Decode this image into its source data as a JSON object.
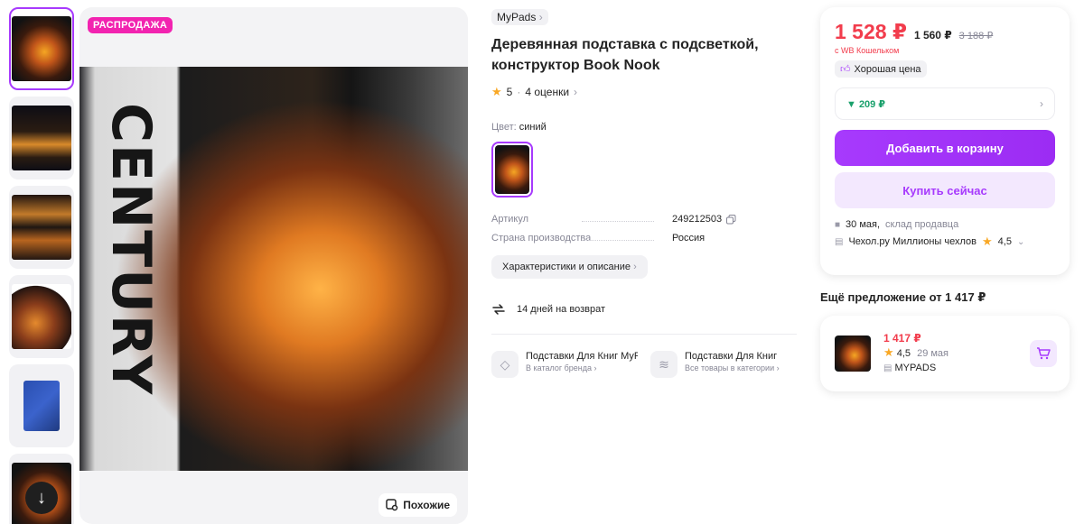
{
  "gallery": {
    "sale_badge": "РАСПРОДАЖА",
    "similar_label": "Похожие",
    "spine_text": "CENTURY"
  },
  "product": {
    "brand": "MyPads",
    "title": "Деревянная подставка с подсветкой, конструктор Book Nook",
    "rating": "5",
    "reviews": "4 оценки",
    "color_label": "Цвет:",
    "color_value": "синий",
    "specs": [
      {
        "key": "Артикул",
        "value": "249212503"
      },
      {
        "key": "Страна производства",
        "value": "Россия"
      }
    ],
    "characteristics_button": "Характеристики и описание",
    "return_policy": "14 дней на возврат",
    "categories": [
      {
        "name": "Подставки Для Книг MyPads",
        "sub": "В каталог бренда"
      },
      {
        "name": "Подставки Для Книг",
        "sub": "Все товары в категории"
      }
    ]
  },
  "price_card": {
    "price": "1 528 ₽",
    "price_no_wallet": "1 560 ₽",
    "price_old": "3 188 ₽",
    "wallet_note": "с WB Кошельком",
    "good_price": "Хорошая цена",
    "cashback": "▼ 209 ₽",
    "add_to_cart": "Добавить в корзину",
    "buy_now": "Купить сейчас",
    "delivery_date": "30 мая,",
    "delivery_source": "склад продавца",
    "seller_name": "Чехол.ру Миллионы чехлов",
    "seller_rating": "4,5"
  },
  "other_offer": {
    "title": "Ещё предложение от 1 417 ₽",
    "price": "1 417 ₽",
    "rating": "4,5",
    "date": "29 мая",
    "seller": "MYPADS"
  },
  "colors": {
    "accent": "#a73afd",
    "price_red": "#f23c4c",
    "sale_pink": "#f223b0",
    "cashback_green": "#19a06b"
  }
}
